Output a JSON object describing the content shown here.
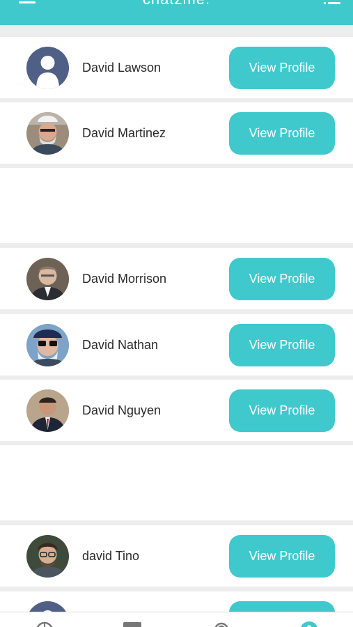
{
  "app": {
    "title": "chatzme.",
    "accent_color": "#40c9cc"
  },
  "header": {
    "left_icon": "hamburger-menu-icon",
    "right_icon": "list-filter-icon"
  },
  "people": [
    {
      "name": "David Lawson",
      "avatar": "default-avatar",
      "button_label": "View Profile"
    },
    {
      "name": "David Martinez",
      "avatar": "photo-avatar",
      "button_label": "View Profile"
    },
    {
      "name": "David Morrison",
      "avatar": "photo-avatar",
      "button_label": "View Profile"
    },
    {
      "name": "David Nathan",
      "avatar": "photo-avatar",
      "button_label": "View Profile"
    },
    {
      "name": "David Nguyen",
      "avatar": "photo-avatar",
      "button_label": "View Profile"
    },
    {
      "name": "david Tino",
      "avatar": "photo-avatar",
      "button_label": "View Profile"
    },
    {
      "name": "",
      "avatar": "default-avatar",
      "button_label": ""
    }
  ],
  "tabbar": {
    "items": [
      {
        "icon": "globe-icon"
      },
      {
        "icon": "chat-icon"
      },
      {
        "icon": "broadcast-icon"
      },
      {
        "icon": "profile-icon",
        "active": true
      }
    ]
  }
}
